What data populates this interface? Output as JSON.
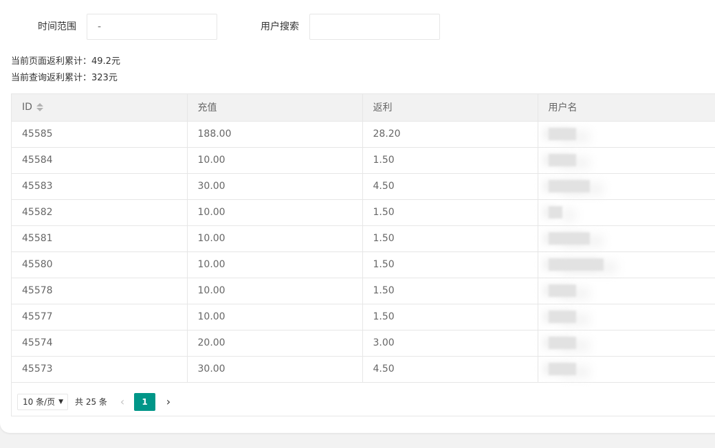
{
  "filters": {
    "time_label": "时间范围",
    "time_value": "-",
    "user_label": "用户搜索",
    "user_value": ""
  },
  "summary": {
    "page_rebate": "当前页面返利累计：49.2元",
    "query_rebate": "当前查询返利累计：323元"
  },
  "table": {
    "columns": [
      "ID",
      "充值",
      "返利",
      "用户名"
    ],
    "rows": [
      {
        "id": "45585",
        "charge": "188.00",
        "rebate": "28.20"
      },
      {
        "id": "45584",
        "charge": "10.00",
        "rebate": "1.50"
      },
      {
        "id": "45583",
        "charge": "30.00",
        "rebate": "4.50"
      },
      {
        "id": "45582",
        "charge": "10.00",
        "rebate": "1.50"
      },
      {
        "id": "45581",
        "charge": "10.00",
        "rebate": "1.50"
      },
      {
        "id": "45580",
        "charge": "10.00",
        "rebate": "1.50"
      },
      {
        "id": "45578",
        "charge": "10.00",
        "rebate": "1.50"
      },
      {
        "id": "45577",
        "charge": "10.00",
        "rebate": "1.50"
      },
      {
        "id": "45574",
        "charge": "20.00",
        "rebate": "3.00"
      },
      {
        "id": "45573",
        "charge": "30.00",
        "rebate": "4.50"
      }
    ]
  },
  "pager": {
    "page_size": "10 条/页",
    "total": "共 25 条",
    "current_page": "1",
    "prev_icon": "‹",
    "next_icon": "›",
    "dropdown_icon": "▼"
  },
  "colors": {
    "accent": "#009688",
    "border": "#e6e6e6",
    "header_bg": "#f2f2f2"
  }
}
